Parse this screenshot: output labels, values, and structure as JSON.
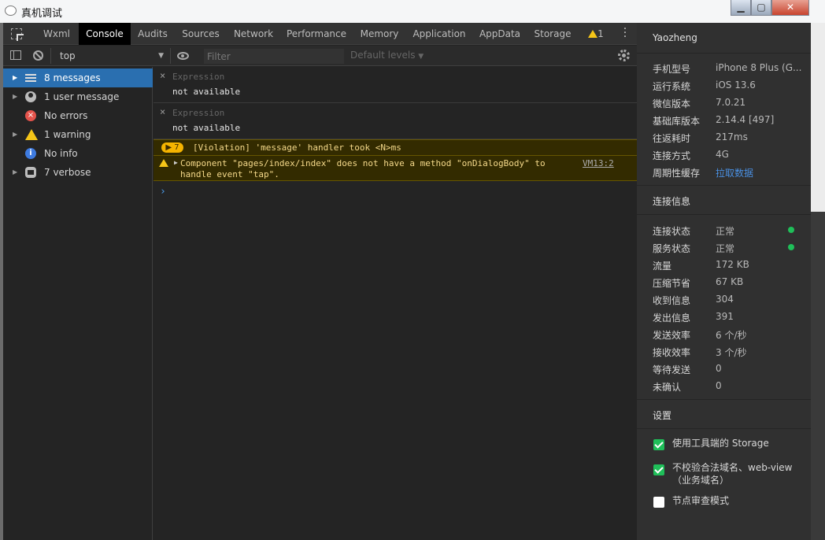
{
  "window": {
    "title": "真机调试",
    "min": "▁",
    "max": "▢",
    "close": "✕"
  },
  "tabs": [
    {
      "label": "Wxml"
    },
    {
      "label": "Console"
    },
    {
      "label": "Audits"
    },
    {
      "label": "Sources"
    },
    {
      "label": "Network"
    },
    {
      "label": "Performance"
    },
    {
      "label": "Memory"
    },
    {
      "label": "Application"
    },
    {
      "label": "AppData"
    },
    {
      "label": "Storage"
    }
  ],
  "warning_count": "1",
  "toolbar": {
    "context": "top",
    "filter_placeholder": "Filter",
    "levels": "Default levels"
  },
  "sidebar": {
    "items": [
      {
        "label": "8 messages"
      },
      {
        "label": "1 user message"
      },
      {
        "label": "No errors"
      },
      {
        "label": "1 warning"
      },
      {
        "label": "No info"
      },
      {
        "label": "7 verbose"
      }
    ]
  },
  "console": {
    "expressions": [
      {
        "label": "Expression",
        "value": "not available"
      },
      {
        "label": "Expression",
        "value": "not available"
      }
    ],
    "violation": {
      "count": "7",
      "text": "[Violation] 'message' handler took <N>ms"
    },
    "warning": {
      "text": "Component \"pages/index/index\" does not have a method \"onDialogBody\" to handle event \"tap\".",
      "source": "VM13:2"
    },
    "prompt": "›"
  },
  "device": {
    "user": "Yaozheng",
    "rows": [
      {
        "k": "手机型号",
        "v": "iPhone 8 Plus (G..."
      },
      {
        "k": "运行系统",
        "v": "iOS 13.6"
      },
      {
        "k": "微信版本",
        "v": "7.0.21"
      },
      {
        "k": "基础库版本",
        "v": "2.14.4 [497]"
      },
      {
        "k": "往返耗时",
        "v": "217ms"
      },
      {
        "k": "连接方式",
        "v": "4G"
      },
      {
        "k": "周期性缓存",
        "v": "拉取数据"
      }
    ]
  },
  "connection": {
    "title": "连接信息",
    "rows": [
      {
        "k": "连接状态",
        "v": "正常"
      },
      {
        "k": "服务状态",
        "v": "正常"
      },
      {
        "k": "流量",
        "v": "172 KB"
      },
      {
        "k": "压缩节省",
        "v": "67 KB"
      },
      {
        "k": "收到信息",
        "v": "304"
      },
      {
        "k": "发出信息",
        "v": "391"
      },
      {
        "k": "发送效率",
        "v": "6 个/秒"
      },
      {
        "k": "接收效率",
        "v": "3 个/秒"
      },
      {
        "k": "等待发送",
        "v": "0"
      },
      {
        "k": "未确认",
        "v": "0"
      }
    ]
  },
  "settings": {
    "title": "设置",
    "options": [
      {
        "label": "使用工具端的 Storage",
        "checked": true
      },
      {
        "label": "不校验合法域名、web-view（业务域名）",
        "checked": true
      },
      {
        "label": "节点审查模式",
        "checked": false
      }
    ]
  },
  "colors": {
    "accent": "#2a6fb0",
    "ok": "#1fbf59",
    "warning": "#f5c518",
    "link": "#4a90e2"
  }
}
